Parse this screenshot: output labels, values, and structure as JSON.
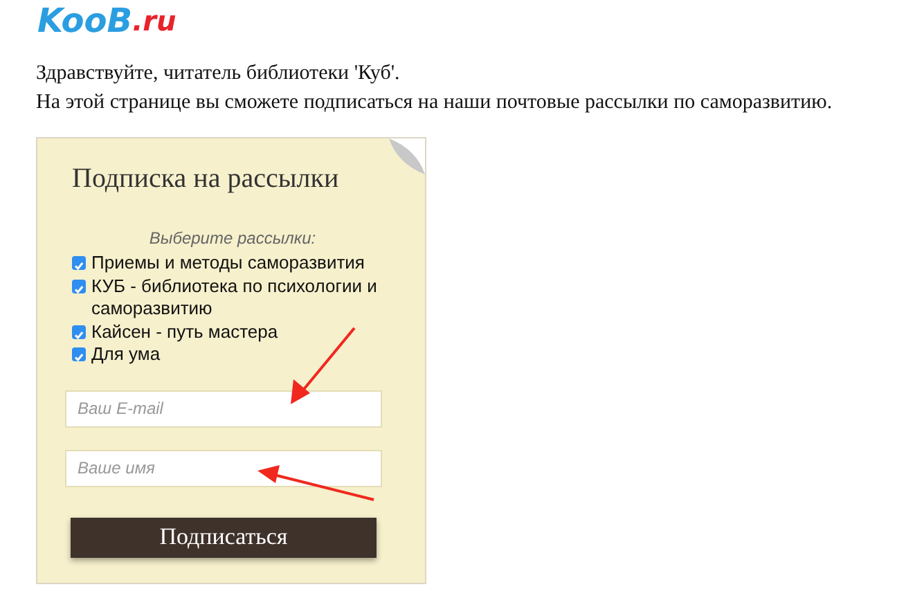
{
  "logo": {
    "name": "KooB",
    "suffix": ".ru"
  },
  "intro": [
    "Здравствуйте, читатель библиотеки 'Куб'.",
    "На этой странице вы сможете подписаться на наши почтовые рассылки по саморазвитию."
  ],
  "form": {
    "title": "Подписка на рассылки",
    "prompt": "Выберите рассылки:",
    "options": [
      {
        "label": "Приемы и методы саморазвития",
        "checked": true
      },
      {
        "label": "КУБ - библиотека по психологии и саморазвитию",
        "checked": true
      },
      {
        "label": "Кайсен - путь мастера",
        "checked": true
      },
      {
        "label": "Для ума",
        "checked": true
      }
    ],
    "fields": [
      {
        "placeholder": "Ваш E-mail"
      },
      {
        "placeholder": "Ваше имя"
      }
    ],
    "submit": "Подписаться"
  }
}
